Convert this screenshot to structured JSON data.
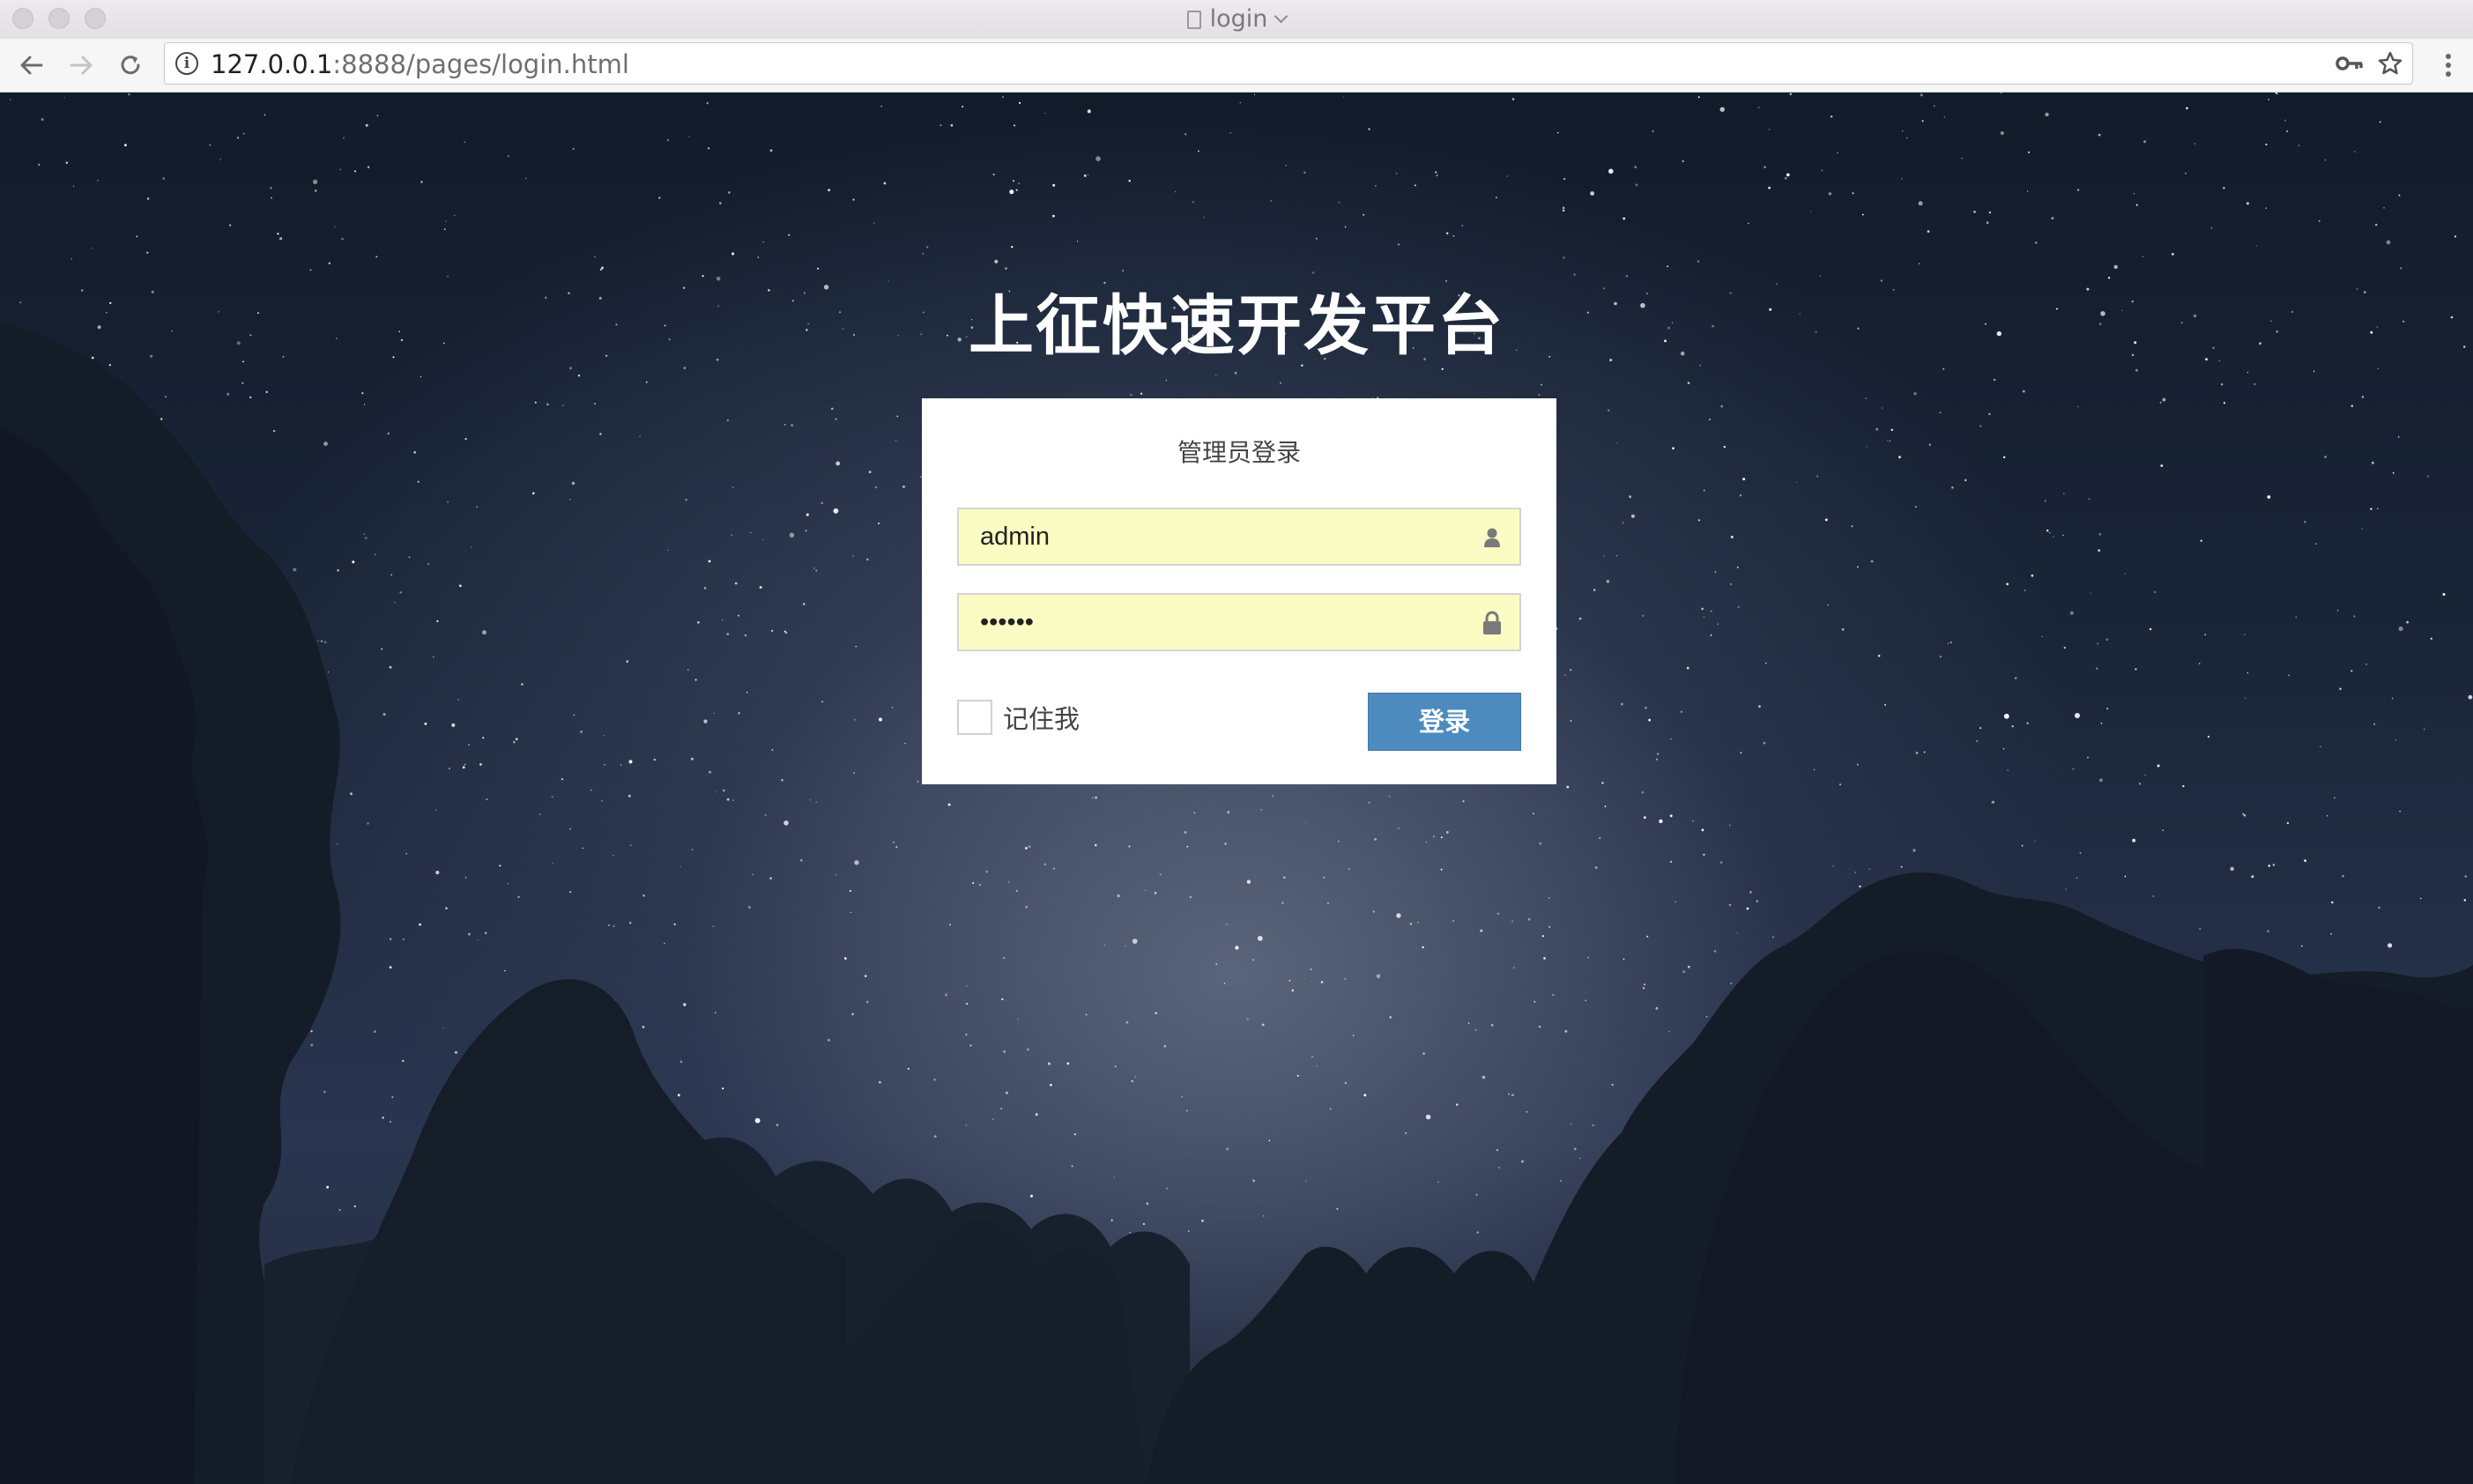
{
  "window": {
    "title": "login",
    "traffic_lights": [
      "close",
      "minimize",
      "zoom"
    ]
  },
  "toolbar": {
    "back_icon": "arrow-left-icon",
    "forward_icon": "arrow-right-icon",
    "reload_icon": "reload-icon",
    "url_host": "127.0.0.1",
    "url_rest": ":8888/pages/login.html",
    "key_icon": "key-icon",
    "bookmark_icon": "star-icon",
    "menu_icon": "kebab-menu-icon"
  },
  "page": {
    "title": "上征快速开发平台",
    "login_box": {
      "title": "管理员登录",
      "username": {
        "value": "admin",
        "icon": "user-icon"
      },
      "password": {
        "value": "123456",
        "icon": "lock-icon"
      },
      "remember_label": "记住我",
      "remember_checked": false,
      "submit_label": "登录"
    }
  },
  "colors": {
    "button_bg": "#4d8abd",
    "input_bg": "#fafcc4",
    "box_bg": "#ffffff",
    "sky_dark": "#141d2c"
  }
}
